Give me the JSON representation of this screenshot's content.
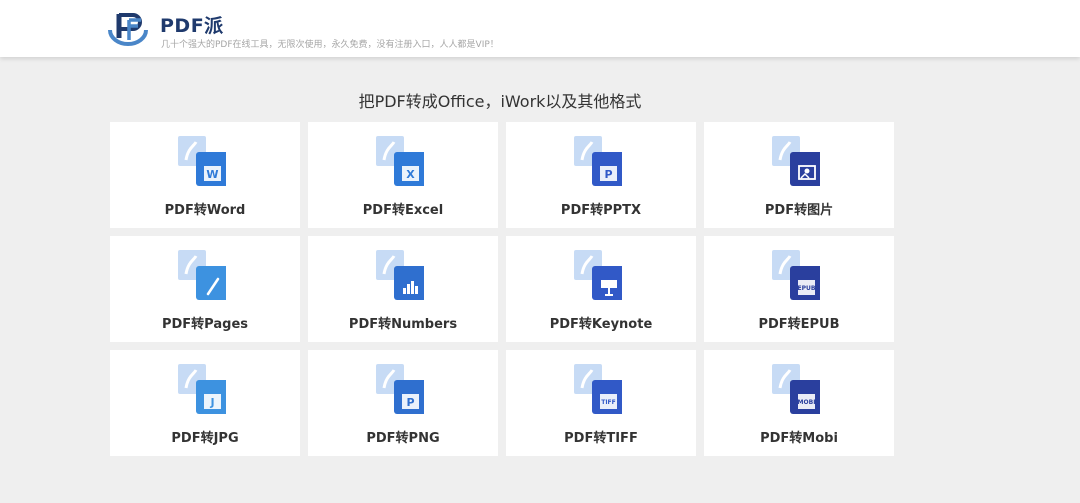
{
  "header": {
    "brand_name": "PDF派",
    "tagline": "几十个强大的PDF在线工具，无限次使用，永久免费，没有注册入口，人人都是VIP！",
    "logo_icon": "pdfpai-logo-icon"
  },
  "main": {
    "title": "把PDF转成Office，iWork以及其他格式"
  },
  "colors": {
    "background": "#efefef",
    "card": "#ffffff",
    "brand": "#1f3a6d",
    "icon_front": "#2a6fd1",
    "icon_back": "#c7dbf5"
  },
  "tools": [
    {
      "label": "PDF转Word",
      "icon": "word-icon",
      "glyph": "W",
      "color": "#2f7ad8"
    },
    {
      "label": "PDF转Excel",
      "icon": "excel-icon",
      "glyph": "X",
      "color": "#2f7ad8"
    },
    {
      "label": "PDF转PPTX",
      "icon": "pptx-icon",
      "glyph": "P",
      "color": "#3159c7"
    },
    {
      "label": "PDF转图片",
      "icon": "image-icon",
      "glyph": "img",
      "color": "#2a3f9e"
    },
    {
      "label": "PDF转Pages",
      "icon": "pages-icon",
      "glyph": "pen",
      "color": "#3d92e0"
    },
    {
      "label": "PDF转Numbers",
      "icon": "numbers-icon",
      "glyph": "bars",
      "color": "#2f6fcf"
    },
    {
      "label": "PDF转Keynote",
      "icon": "keynote-icon",
      "glyph": "podium",
      "color": "#3159c7"
    },
    {
      "label": "PDF转EPUB",
      "icon": "epub-icon",
      "glyph": "EPUB",
      "color": "#2a3f9e"
    },
    {
      "label": "PDF转JPG",
      "icon": "jpg-icon",
      "glyph": "J",
      "color": "#3d92e0"
    },
    {
      "label": "PDF转PNG",
      "icon": "png-icon",
      "glyph": "P",
      "color": "#2f6fcf"
    },
    {
      "label": "PDF转TIFF",
      "icon": "tiff-icon",
      "glyph": "TIFF",
      "color": "#3159c7"
    },
    {
      "label": "PDF转Mobi",
      "icon": "mobi-icon",
      "glyph": "MOBI",
      "color": "#2a3f9e"
    }
  ]
}
